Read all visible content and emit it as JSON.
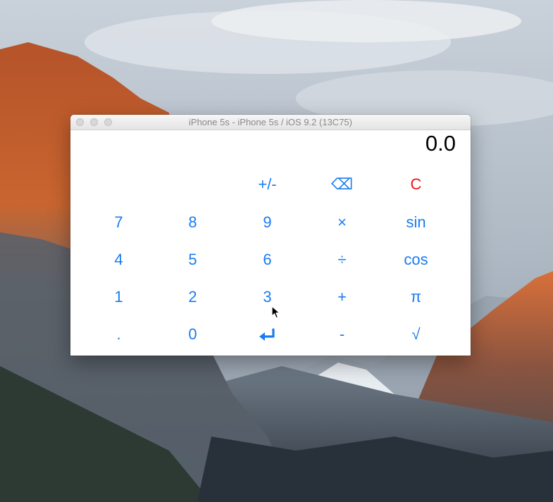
{
  "window": {
    "title": "iPhone 5s - iPhone 5s / iOS 9.2 (13C75)"
  },
  "calculator": {
    "display": "0.0",
    "keys": {
      "sign": "+/-",
      "backspace": "⌫",
      "clear": "C",
      "seven": "7",
      "eight": "8",
      "nine": "9",
      "multiply": "×",
      "sin": "sin",
      "four": "4",
      "five": "5",
      "six": "6",
      "divide": "÷",
      "cos": "cos",
      "one": "1",
      "two": "2",
      "three": "3",
      "plus": "+",
      "pi": "π",
      "decimal": ".",
      "zero": "0",
      "enter": "enter-icon",
      "minus": "-",
      "sqrt": "√"
    }
  },
  "colors": {
    "key_text": "#1a7cf0",
    "clear_text": "#f01414",
    "display_text": "#000000"
  }
}
